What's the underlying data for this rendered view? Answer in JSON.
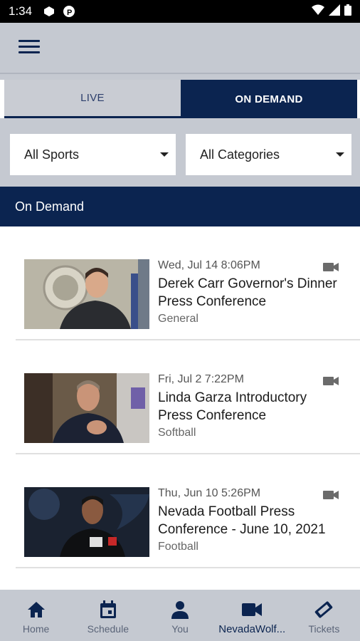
{
  "status_bar": {
    "time": "1:34"
  },
  "tabs": [
    {
      "label": "LIVE"
    },
    {
      "label": "ON DEMAND"
    }
  ],
  "filters": {
    "sports": "All Sports",
    "categories": "All Categories"
  },
  "section": {
    "title": "On Demand"
  },
  "videos": [
    {
      "date": "Wed, Jul 14 8:06PM",
      "title": "Derek Carr Governor's Dinner Press Conference",
      "category": "General"
    },
    {
      "date": "Fri, Jul 2 7:22PM",
      "title": "Linda Garza Introductory Press Conference",
      "category": "Softball"
    },
    {
      "date": "Thu, Jun 10 5:26PM",
      "title": "Nevada Football Press Conference - June 10, 2021",
      "category": "Football"
    }
  ],
  "bottom_nav": [
    {
      "label": "Home",
      "icon": "home-icon"
    },
    {
      "label": "Schedule",
      "icon": "calendar-icon"
    },
    {
      "label": "You",
      "icon": "person-icon"
    },
    {
      "label": "NevadaWolf...",
      "icon": "video-camera-icon"
    },
    {
      "label": "Tickets",
      "icon": "ticket-icon"
    }
  ],
  "colors": {
    "navy": "#0b2450",
    "gray_bar": "#c5c9d1"
  }
}
